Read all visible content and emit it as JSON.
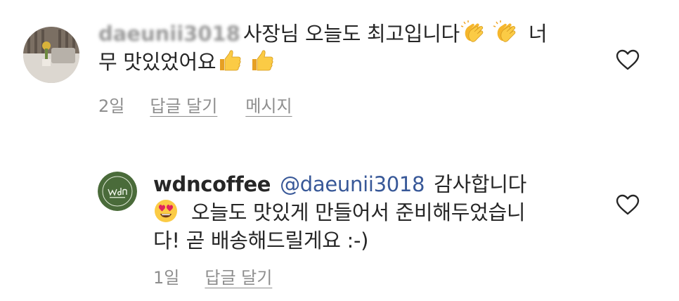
{
  "comments": [
    {
      "username": "daeunii3018",
      "text_line1": "사장님 오늘도 최고입니다",
      "text_line1_tail": "너",
      "text_line2": "무 맛있었어요",
      "emojis_line1": [
        "clapping-hands",
        "clapping-hands"
      ],
      "emojis_line2": [
        "thumbs-up",
        "thumbs-up"
      ],
      "age": "2일",
      "reply_label": "답글 달기",
      "message_label": "메시지"
    },
    {
      "username": "wdncoffee",
      "mention": "@daeunii3018",
      "text_line1": "감사합니다",
      "text_line2": "오늘도 맛있게 만들어서 준비해두었습니",
      "text_line3": "다! 곧 배송해드릴게요 :-)",
      "emoji": "heart-eyes",
      "age": "1일",
      "reply_label": "답글 달기"
    }
  ],
  "colors": {
    "text": "#262626",
    "secondary": "#8e8e8e",
    "mention": "#385898",
    "brand_green": "#4a6b3a"
  },
  "icons": {
    "like": "heart-outline-icon"
  }
}
